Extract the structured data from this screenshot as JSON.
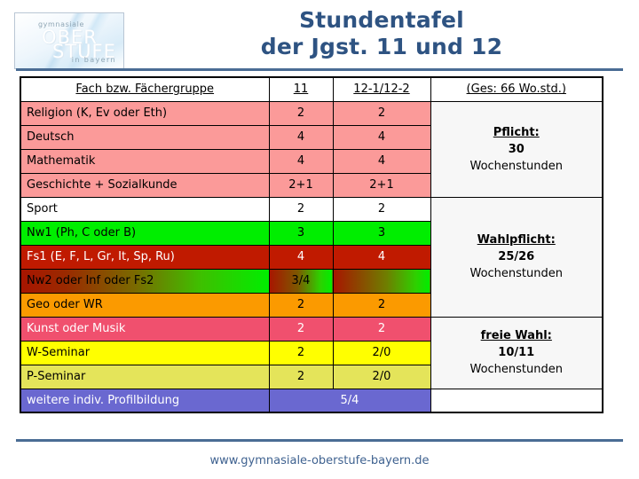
{
  "logo": {
    "line1": "gymnasiale",
    "line2": "OBER",
    "line3": "STUFE",
    "line4": "in bayern"
  },
  "title": {
    "line1": "Stundentafel",
    "line2": "der Jgst. 11 und 12"
  },
  "table": {
    "headers": {
      "subject": "Fach bzw. Fächergruppe",
      "year11": "11",
      "year12": "12-1/12-2",
      "total": "(Ges: 66 Wo.std.)"
    },
    "rows": [
      {
        "subject": "Religion (K, Ev oder Eth)",
        "y11": "2",
        "y12": "2",
        "tint": "t-pflicht",
        "bold": false
      },
      {
        "subject": "Deutsch",
        "y11": "4",
        "y12": "4",
        "tint": "t-pflicht",
        "bold": true
      },
      {
        "subject": "Mathematik",
        "y11": "4",
        "y12": "4",
        "tint": "t-pflicht",
        "bold": true
      },
      {
        "subject": "Geschichte + Sozialkunde",
        "y11": "2+1",
        "y12": "2+1",
        "tint": "t-pflicht",
        "bold": false
      },
      {
        "subject": "Sport",
        "y11": "2",
        "y12": "2",
        "tint": "t-white",
        "bold": false
      },
      {
        "subject": "Nw1 (Ph, C oder B)",
        "y11": "3",
        "y12": "3",
        "tint": "t-green",
        "bold": false
      },
      {
        "subject": "Fs1 (E, F, L, Gr, It, Sp, Ru)",
        "y11": "4",
        "y12": "4",
        "tint": "t-darkred",
        "bold": false
      },
      {
        "subject": "Nw2 oder Inf oder Fs2",
        "y11": "3/4",
        "y12": "",
        "tint": "gradient",
        "bold": false
      },
      {
        "subject": "Geo oder WR",
        "y11": "2",
        "y12": "2",
        "tint": "t-orange",
        "bold": false
      },
      {
        "subject": "Kunst oder Musik",
        "y11": "2",
        "y12": "2",
        "tint": "t-pinkred",
        "bold": false
      },
      {
        "subject": "W-Seminar",
        "y11": "2",
        "y12": "2/0",
        "tint": "t-yellow",
        "bold": false
      },
      {
        "subject": "P-Seminar",
        "y11": "2",
        "y12": "2/0",
        "tint": "t-yellow2",
        "bold": false
      },
      {
        "subject": "weitere indiv. Profilbildung",
        "y11": "5/4",
        "y12": null,
        "tint": "t-blue",
        "bold": false,
        "merged": true
      }
    ],
    "summary": [
      {
        "title": "Pflicht:",
        "value": "30",
        "unit": "Wochenstunden",
        "span": 4
      },
      {
        "title": "Wahlpflicht:",
        "value": "25/26",
        "unit": "Wochenstunden",
        "span": 5
      },
      {
        "title": "freie Wahl:",
        "value": "10/11",
        "unit": "Wochenstunden",
        "span": 3
      }
    ]
  },
  "footer": {
    "url": "www.gymnasiale-oberstufe-bayern.de"
  },
  "colors": {
    "title_blue": "#2e5382",
    "rule_blue": "#4a6c94",
    "pflicht_pink": "#fb9a99",
    "green": "#00ee00",
    "dark_red": "#c01a00",
    "orange": "#fb9a00",
    "pink_red": "#f0506e",
    "yellow": "#ffff00",
    "yellow_dim": "#e4e45a",
    "periwinkle": "#6a68d0",
    "summary_bg": "#f7f7f7"
  }
}
